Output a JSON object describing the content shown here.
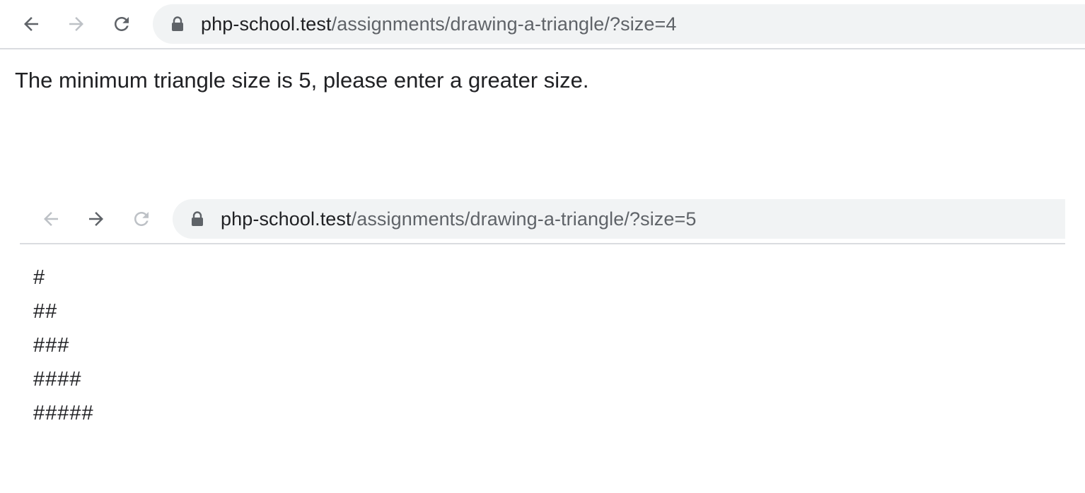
{
  "browser_1": {
    "url_host": "php-school.test",
    "url_path": "/assignments/drawing-a-triangle/?size=4",
    "back_enabled": true,
    "forward_enabled": false
  },
  "error_message": "The minimum triangle size is 5, please enter a greater size.",
  "browser_2": {
    "url_host": "php-school.test",
    "url_path": "/assignments/drawing-a-triangle/?size=5",
    "back_enabled": false,
    "forward_enabled": true
  },
  "triangle_rows": [
    "#",
    "##",
    "###",
    "####",
    "#####"
  ],
  "colors": {
    "text": "#202124",
    "url_path": "#5f6368",
    "omnibox_bg": "#f1f3f4",
    "icon_active": "#5f6368",
    "icon_disabled": "#bdc1c6",
    "divider": "#dadce0"
  }
}
